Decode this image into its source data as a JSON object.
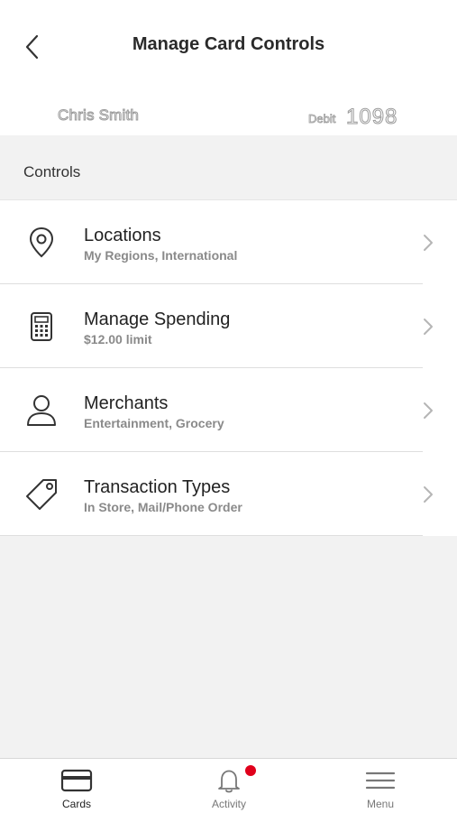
{
  "header": {
    "title": "Manage Card Controls",
    "back_icon": "chevron-left-icon"
  },
  "card": {
    "holder_name": "Chris Smith",
    "type": "Debit",
    "last4": "1098"
  },
  "section": {
    "label": "Controls"
  },
  "controls": [
    {
      "label": "Locations",
      "sub": "My Regions, International",
      "icon": "location-pin-icon"
    },
    {
      "label": "Manage Spending",
      "sub": "$12.00 limit",
      "icon": "calculator-icon"
    },
    {
      "label": "Merchants",
      "sub": "Entertainment, Grocery",
      "icon": "person-icon"
    },
    {
      "label": "Transaction Types",
      "sub": "In Store, Mail/Phone Order",
      "icon": "tag-icon"
    }
  ],
  "tabbar": {
    "tabs": [
      {
        "label": "Cards",
        "icon": "card-icon",
        "active": true
      },
      {
        "label": "Activity",
        "icon": "bell-icon",
        "active": false
      },
      {
        "label": "Menu",
        "icon": "hamburger-icon",
        "active": false
      }
    ],
    "badge_color": "#e0001b"
  },
  "colors": {
    "background": "#f2f2f2",
    "surface": "#ffffff",
    "text": "#222222",
    "subtext": "#8a8a8a"
  }
}
